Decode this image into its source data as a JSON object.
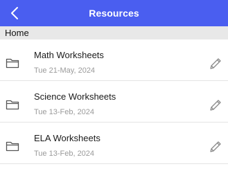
{
  "header": {
    "title": "Resources",
    "back_icon": "chevron-left-icon",
    "background_color": "#4a5ef0"
  },
  "section": {
    "label": "Home"
  },
  "items": [
    {
      "title": "Math Worksheets",
      "date": "Tue 21-May, 2024",
      "icon": "folder-icon",
      "action_icon": "pencil-icon"
    },
    {
      "title": "Science Worksheets",
      "date": "Tue 13-Feb, 2024",
      "icon": "folder-icon",
      "action_icon": "pencil-icon"
    },
    {
      "title": "ELA Worksheets",
      "date": "Tue 13-Feb, 2024",
      "icon": "folder-icon",
      "action_icon": "pencil-icon"
    }
  ]
}
